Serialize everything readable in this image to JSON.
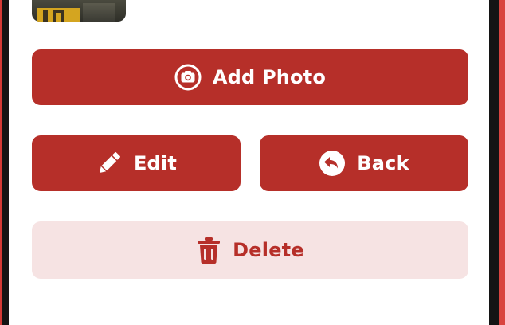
{
  "actions": {
    "add_photo": {
      "label": "Add Photo",
      "icon": "camera-icon"
    },
    "edit": {
      "label": "Edit",
      "icon": "pencil-icon"
    },
    "back": {
      "label": "Back",
      "icon": "back-arrow-icon"
    },
    "delete": {
      "label": "Delete",
      "icon": "trash-icon"
    }
  },
  "colors": {
    "primary": "#b62f29",
    "danger_tint": "#f6e3e3",
    "on_primary": "#ffffff",
    "device_frame": "#141414",
    "device_case": "#d9443f"
  }
}
